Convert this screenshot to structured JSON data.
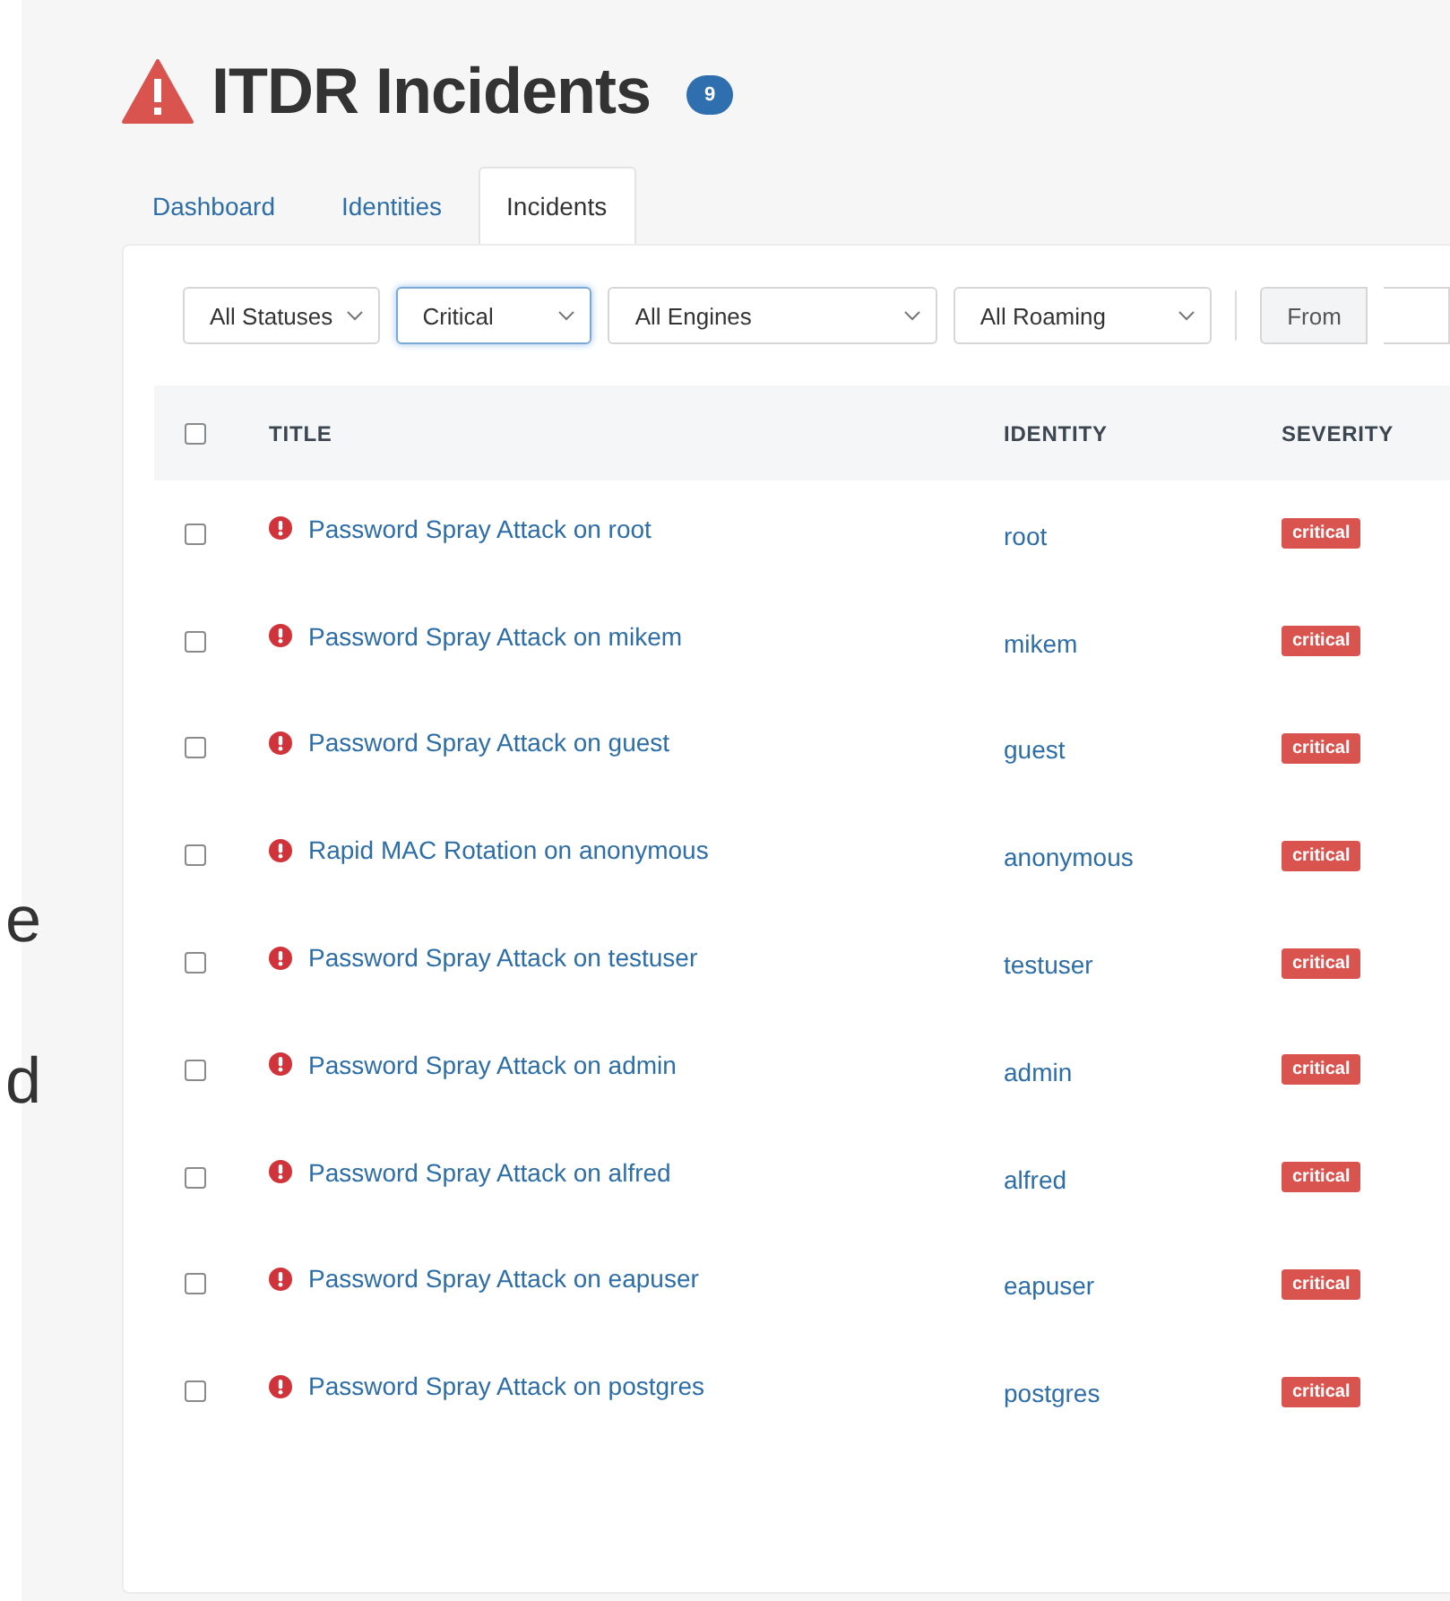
{
  "edge_fragments": [
    "e",
    "d"
  ],
  "header": {
    "title": "ITDR Incidents",
    "count": "9"
  },
  "tabs": [
    {
      "label": "Dashboard",
      "selected": false
    },
    {
      "label": "Identities",
      "selected": false
    },
    {
      "label": "Incidents",
      "selected": true
    }
  ],
  "filters": [
    {
      "value": "All Statuses",
      "focused": false
    },
    {
      "value": "Critical",
      "focused": true
    },
    {
      "value": "All Engines",
      "focused": false
    },
    {
      "value": "All Roaming",
      "focused": false
    }
  ],
  "date_range": {
    "label": "From"
  },
  "table": {
    "select_all": {
      "checked": false
    },
    "columns": [
      "TITLE",
      "IDENTITY",
      "SEVERITY"
    ],
    "rows": [
      {
        "checked": false,
        "title": "Password Spray Attack on root",
        "identity": "root",
        "severity": "critical"
      },
      {
        "checked": false,
        "title": "Password Spray Attack on mikem",
        "identity": "mikem",
        "severity": "critical"
      },
      {
        "checked": false,
        "title": "Password Spray Attack on guest",
        "identity": "guest",
        "severity": "critical"
      },
      {
        "checked": false,
        "title": "Rapid MAC Rotation on anonymous",
        "identity": "anonymous",
        "severity": "critical"
      },
      {
        "checked": false,
        "title": "Password Spray Attack on testuser",
        "identity": "testuser",
        "severity": "critical"
      },
      {
        "checked": false,
        "title": "Password Spray Attack on admin",
        "identity": "admin",
        "severity": "critical"
      },
      {
        "checked": false,
        "title": "Password Spray Attack on alfred",
        "identity": "alfred",
        "severity": "critical"
      },
      {
        "checked": false,
        "title": "Password Spray Attack on eapuser",
        "identity": "eapuser",
        "severity": "critical"
      },
      {
        "checked": false,
        "title": "Password Spray Attack on postgres",
        "identity": "postgres",
        "severity": "critical"
      }
    ]
  }
}
